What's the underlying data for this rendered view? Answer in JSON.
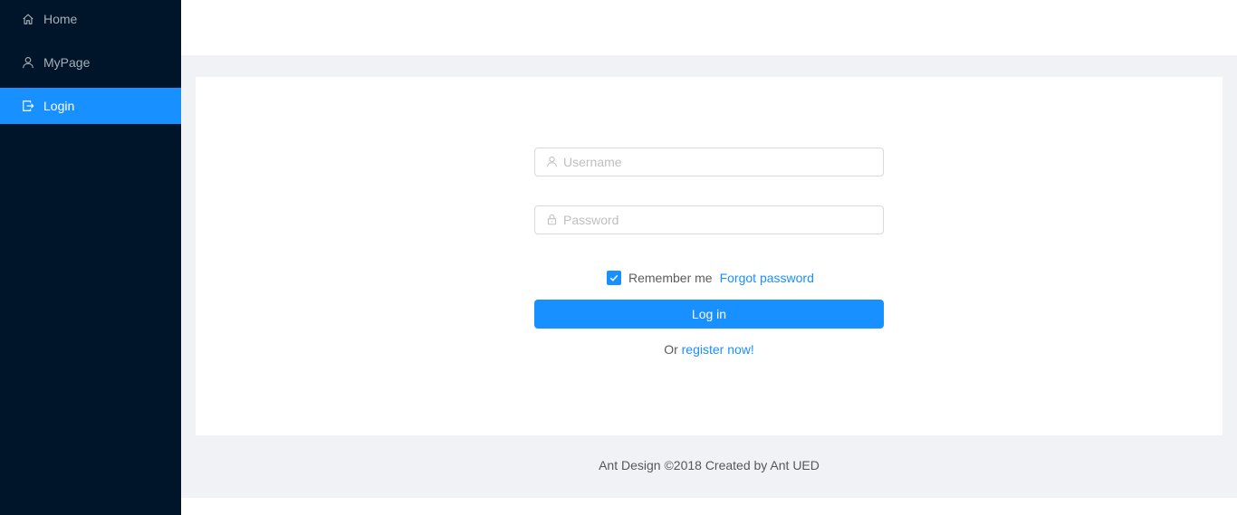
{
  "sidebar": {
    "items": [
      {
        "label": "Home",
        "icon": "home-icon",
        "selected": false
      },
      {
        "label": "MyPage",
        "icon": "user-icon",
        "selected": false
      },
      {
        "label": "Login",
        "icon": "logout-icon",
        "selected": true
      }
    ]
  },
  "login_form": {
    "username_placeholder": "Username",
    "username_value": "",
    "password_placeholder": "Password",
    "password_value": "",
    "remember_label": "Remember me",
    "remember_checked": true,
    "forgot_label": "Forgot password",
    "submit_label": "Log in",
    "register_prefix": "Or",
    "register_link": "register now!"
  },
  "footer": {
    "text": "Ant Design ©2018 Created by Ant UED"
  },
  "colors": {
    "sider_bg": "#001529",
    "primary": "#1890ff",
    "layout_bg": "#f0f2f5"
  }
}
